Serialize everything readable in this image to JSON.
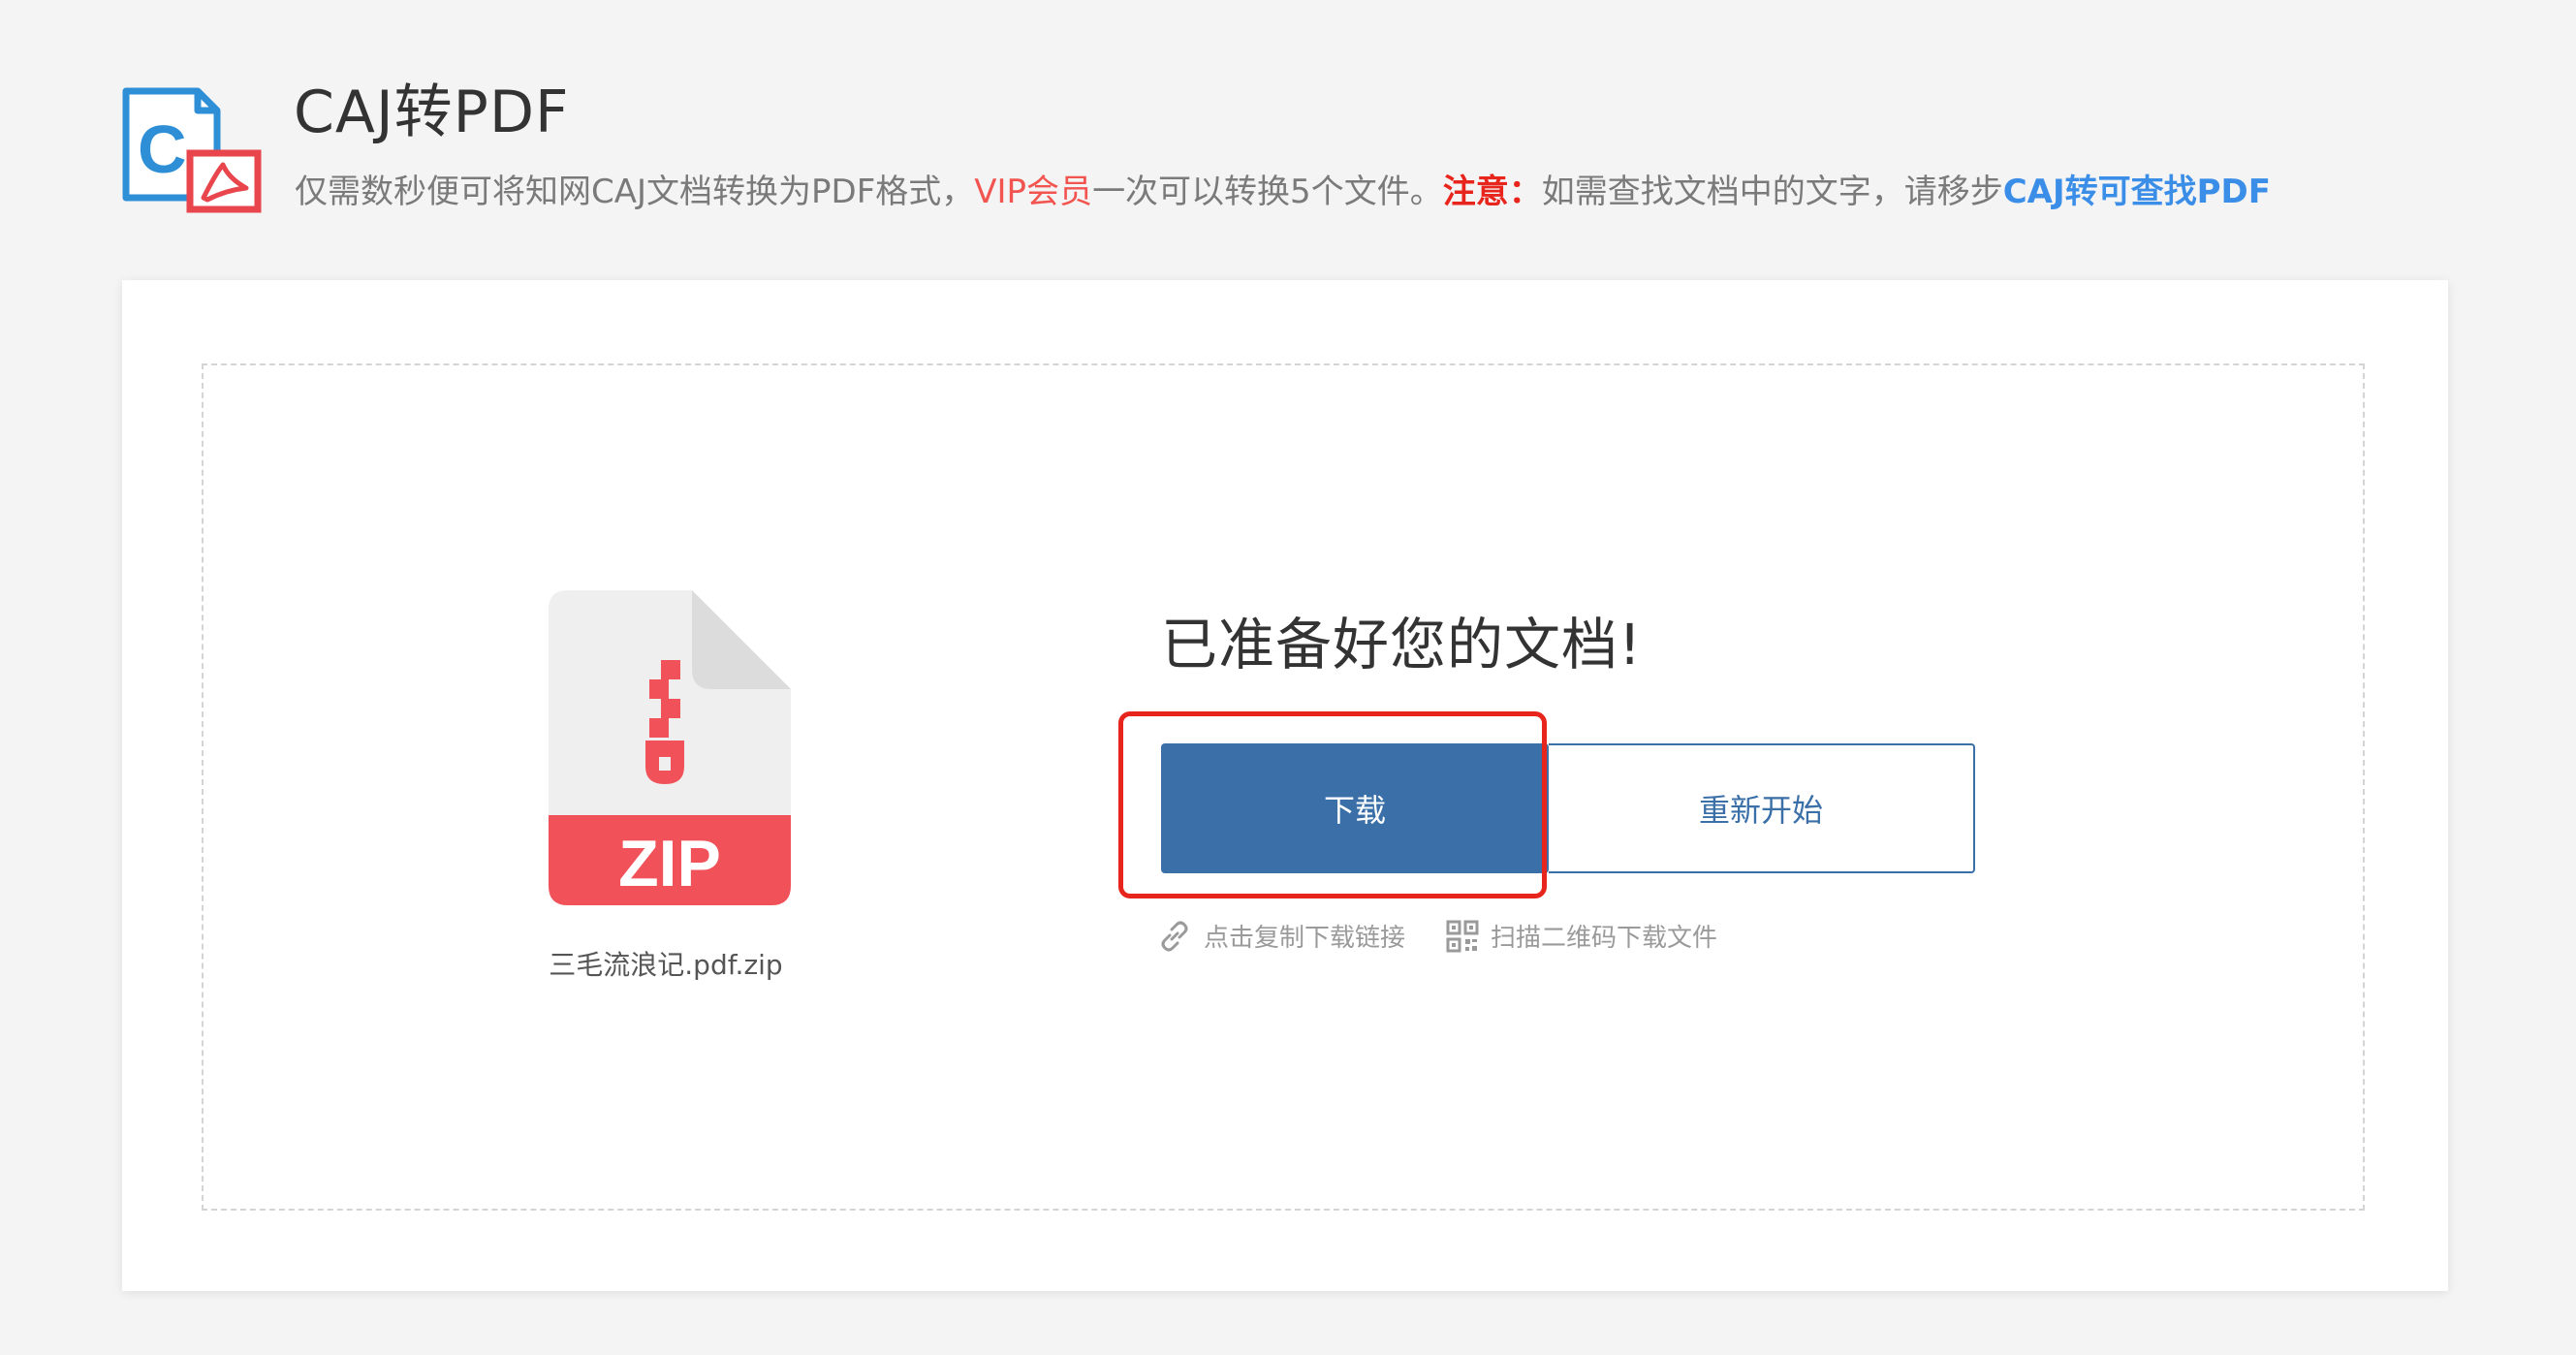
{
  "header": {
    "title": "CAJ转PDF",
    "icon": "caj-to-pdf-icon",
    "description": {
      "part1": "仅需数秒便可将知网CAJ文档转换为PDF格式，",
      "vip": "VIP会员",
      "part2": "一次可以转换5个文件。",
      "note_label": "注意：",
      "part3": "如需查找文档中的文字，请移步",
      "link": "CAJ转可查找PDF"
    }
  },
  "result": {
    "file_icon": "zip-file-icon",
    "file_type_label": "ZIP",
    "file_name": "三毛流浪记.pdf.zip",
    "ready_title": "已准备好您的文档!",
    "download_label": "下载",
    "restart_label": "重新开始",
    "copy_link_icon": "link-icon",
    "copy_link_label": "点击复制下载链接",
    "qr_icon": "qr-code-icon",
    "qr_label": "扫描二维码下载文件"
  },
  "colors": {
    "accent_blue": "#3a6fa8",
    "highlight_red": "#e8251c",
    "vip_red": "#f25450",
    "link_blue": "#3b8ee8",
    "zip_red": "#f1525a"
  }
}
